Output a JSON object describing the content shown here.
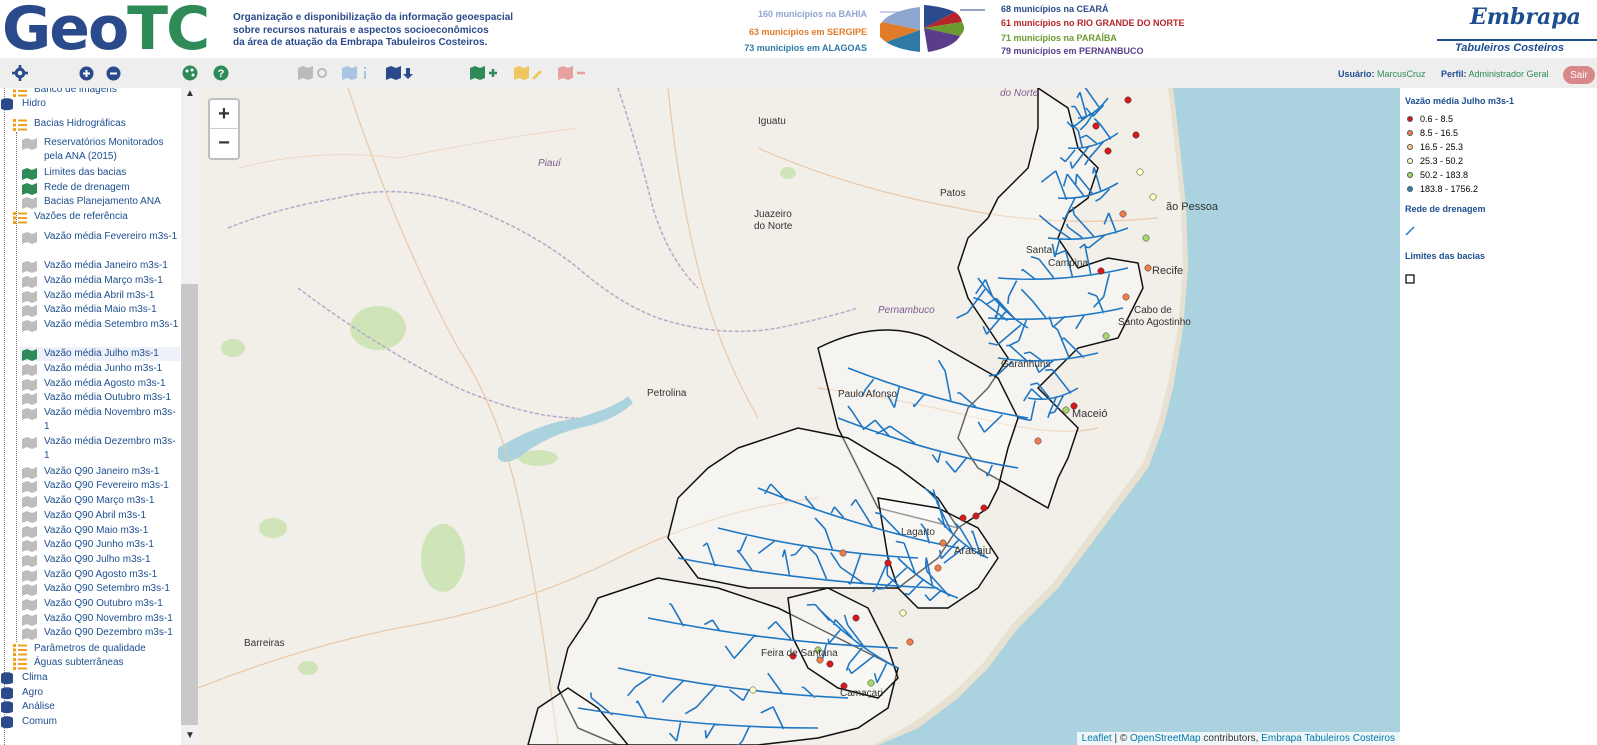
{
  "header": {
    "logo_part1": "Geo",
    "logo_part2": "TC",
    "tagline_line1": "Organização e disponibilização da informação geoespacial",
    "tagline_line2": "sobre recursos naturais e aspectos socioeconômicos",
    "tagline_line3": "da área de atuação da Embrapa Tabuleiros Costeiros.",
    "municipios": {
      "bahia": "160 municípios na BAHIA",
      "sergipe": "63 municípios em SERGIPE",
      "alagoas": "73 municípios em ALAGOAS",
      "ceara": "68 municípios na CEARÁ",
      "rn": "61 municípios no RIO GRANDE DO NORTE",
      "paraiba": "71 municípios na PARAÍBA",
      "pernambuco": "79 municípios em PERNANBUCO"
    },
    "colors": {
      "bahia": "#8fa6d1",
      "sergipe": "#e07b2a",
      "alagoas": "#2e7aa6",
      "ceara": "#2b4a8b",
      "rn": "#b5252a",
      "paraiba": "#6b9b2f",
      "pernambuco": "#5a3d8a"
    },
    "embrapa_brand": "Embrapa",
    "embrapa_sub": "Tabuleiros Costeiros"
  },
  "toolbar": {
    "user_label": "Usuário:",
    "user_value": "MarcusCruz",
    "profile_label": "Perfil:",
    "profile_value": "Administrador Geral",
    "logout": "Sair"
  },
  "sidebar": {
    "items": {
      "banco": "Banco de imagens",
      "hidro": "Hidro",
      "bacias": "Bacias Hidrográficas",
      "reservatorios": "Reservatórios Monitorados pela ANA (2015)",
      "limites": "Limites das bacias",
      "rede": "Rede de drenagem",
      "planejamento": "Bacias Planejamento ANA",
      "vazoes": "Vazões de referência",
      "v_fev": "Vazão média Fevereiro m3s-1",
      "v_jan": "Vazão média Janeiro m3s-1",
      "v_mar": "Vazão média Março m3s-1",
      "v_abr": "Vazão média Abril m3s-1",
      "v_mai": "Vazão média Maio m3s-1",
      "v_set": "Vazão média Setembro m3s-1",
      "v_jul": "Vazão média Julho m3s-1",
      "v_jun": "Vazão média Junho m3s-1",
      "v_ago": "Vazão média Agosto m3s-1",
      "v_out": "Vazão média Outubro m3s-1",
      "v_nov": "Vazão média Novembro m3s-1",
      "v_dez": "Vazão média Dezembro m3s-1",
      "q_jan": "Vazão Q90 Janeiro m3s-1",
      "q_fev": "Vazão Q90 Fevereiro m3s-1",
      "q_mar": "Vazão Q90 Março m3s-1",
      "q_abr": "Vazão Q90 Abril m3s-1",
      "q_mai": "Vazão Q90 Maio m3s-1",
      "q_jun": "Vazão Q90 Junho m3s-1",
      "q_jul": "Vazão Q90 Julho m3s-1",
      "q_ago": "Vazão Q90 Agosto m3s-1",
      "q_set": "Vazão Q90 Setembro m3s-1",
      "q_out": "Vazão Q90 Outubro m3s-1",
      "q_nov": "Vazão Q90 Novembro m3s-1",
      "q_dez": "Vazão Q90 Dezembro m3s-1",
      "parametros": "Parâmetros de qualidade",
      "aguas": "Águas subterrâneas",
      "clima": "Clima",
      "agro": "Agro",
      "analise": "Análise",
      "comum": "Comum"
    }
  },
  "map": {
    "zoom_in": "+",
    "zoom_out": "−",
    "places": {
      "iguatu": "Iguatu",
      "piaui": "Piauí",
      "patos": "Patos",
      "juazeiro1": "Juazeiro",
      "juazeiro2": "do Norte",
      "joao_pessoa": "ão Pessoa",
      "recife": "Recife",
      "cabo1": "Cabo de",
      "cabo2": "Santo Agostinho",
      "pernambuco": "Pernambuco",
      "petrolina": "Petrolina",
      "paulo_afonso": "Paulo Afonso",
      "garanhuns": "Garanhuns",
      "maceio": "Maceió",
      "lagarto": "Lagarto",
      "aracaju": "Aracaju",
      "barreiras": "Barreiras",
      "feira": "Feira de Santana",
      "camacari": "Camaçari",
      "norte": "do Norte",
      "santa": "Santa",
      "campina": "Campina"
    },
    "attribution": {
      "leaflet": "Leaflet",
      "sep": " | © ",
      "osm": "OpenStreetMap",
      "contrib": " contributors, ",
      "embrapa": "Embrapa Tabuleiros Costeiros"
    },
    "colors": {
      "river": "#1f77c4",
      "water": "#aad3df",
      "land": "#f2efe9"
    }
  },
  "legend": {
    "title1": "Vazão média Julho m3s-1",
    "classes": [
      {
        "label": "0.6 - 8.5",
        "color": "#d7191c"
      },
      {
        "label": "8.5 - 16.5",
        "color": "#f07c4a"
      },
      {
        "label": "16.5 - 25.3",
        "color": "#fec980"
      },
      {
        "label": "25.3 - 50.2",
        "color": "#ffffbf"
      },
      {
        "label": "50.2 - 183.8",
        "color": "#a6d96a"
      },
      {
        "label": "183.8 - 1756.2",
        "color": "#2b83ba"
      }
    ],
    "title2": "Rede de drenagem",
    "title3": "Limites das bacias"
  }
}
